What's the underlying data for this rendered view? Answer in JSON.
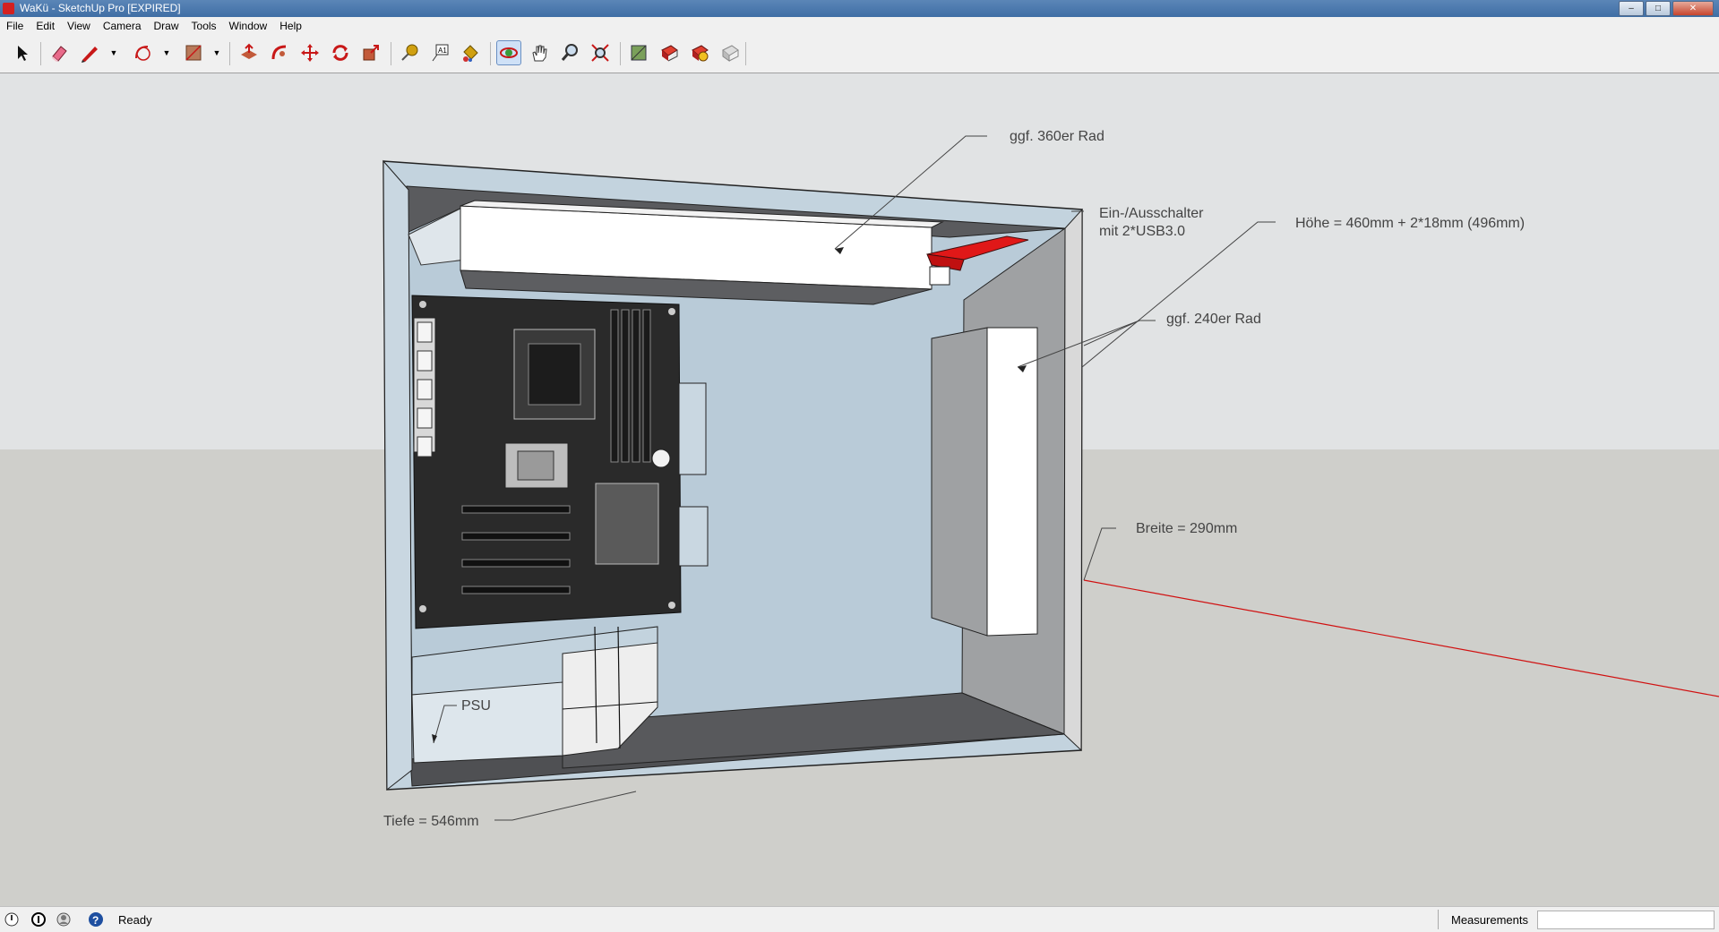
{
  "window": {
    "title": "WaKü - SketchUp Pro [EXPIRED]"
  },
  "menu": [
    "File",
    "Edit",
    "View",
    "Camera",
    "Draw",
    "Tools",
    "Window",
    "Help"
  ],
  "toolbar": [
    "select-tool",
    "eraser-tool",
    "line-tool",
    "arc-tool",
    "rectangle-tool",
    "push-pull-tool",
    "follow-me-tool",
    "move-tool",
    "rotate-tool",
    "scale-tool",
    "tape-measure-tool",
    "text-tool",
    "paint-bucket-tool",
    "orbit-tool",
    "pan-tool",
    "zoom-tool",
    "zoom-extents-tool",
    "3d-warehouse-tool",
    "share-model-tool",
    "get-models-tool",
    "extension-warehouse-tool"
  ],
  "annotations": {
    "rad360": "ggf. 360er Rad",
    "switch_line1": "Ein-/Ausschalter",
    "switch_line2": "mit 2*USB3.0",
    "hoehe": "Höhe = 460mm + 2*18mm (496mm)",
    "rad240": "ggf. 240er Rad",
    "breite": "Breite = 290mm",
    "psu": "PSU",
    "tiefe": "Tiefe = 546mm"
  },
  "status": {
    "text": "Ready",
    "measurements_label": "Measurements",
    "measurements_value": ""
  },
  "colors": {
    "sky": "#e1e3e4",
    "ground": "#cfcfcb",
    "case_panel": "#c3d3de",
    "dark_floor": "#4f5053",
    "axis_red": "#d01010",
    "top_red": "#e01818"
  }
}
